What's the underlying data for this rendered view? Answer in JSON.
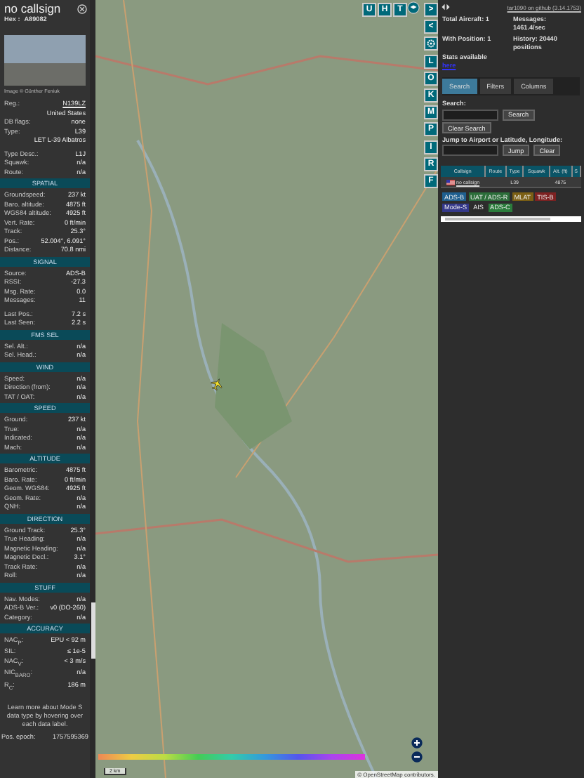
{
  "aircraft_panel": {
    "title": "no callsign",
    "hex_label": "Hex :",
    "hex": "A89082",
    "photo_caption": "Image © Günther Feniuk",
    "sections": [
      {
        "blocks": [
          [
            {
              "kind": "link",
              "label": "Reg.:",
              "value": "N139LZ"
            },
            {
              "kind": "value",
              "value": "United States"
            },
            {
              "kind": "pair",
              "label": "DB flags:",
              "value": "none"
            },
            {
              "kind": "pair",
              "label": "Type:",
              "value": "L39"
            },
            {
              "kind": "value",
              "value": "LET L-39 Albatros"
            }
          ],
          [
            {
              "kind": "pair",
              "label": "Type Desc.:",
              "value": "L1J"
            },
            {
              "kind": "pair",
              "label": "Squawk:",
              "value": "n/a"
            },
            {
              "kind": "pair",
              "label": "Route:",
              "value": "n/a"
            }
          ]
        ]
      },
      {
        "heading": "SPATIAL",
        "blocks": [
          [
            {
              "kind": "pair",
              "label": "Groundspeed:",
              "value": "237 kt"
            },
            {
              "kind": "pair",
              "label": "Baro. altitude:",
              "value": "4875 ft"
            },
            {
              "kind": "pair",
              "label": "WGS84 altitude:",
              "value": "4925 ft"
            },
            {
              "kind": "pair",
              "label": "Vert. Rate:",
              "value": "0 ft/min"
            },
            {
              "kind": "pair",
              "label": "Track:",
              "value": "25.3°"
            },
            {
              "kind": "pair",
              "label": "Pos.:",
              "value": "52.004°, 6.091°"
            },
            {
              "kind": "pair",
              "label": "Distance:",
              "value": "70.8 nmi"
            }
          ]
        ]
      },
      {
        "heading": "SIGNAL",
        "blocks": [
          [
            {
              "kind": "pair",
              "label": "Source:",
              "value": "ADS-B"
            },
            {
              "kind": "pair",
              "label": "RSSI:",
              "value": "-27.3"
            },
            {
              "kind": "pair",
              "label": "Msg. Rate:",
              "value": "0.0"
            },
            {
              "kind": "pair",
              "label": "Messages:",
              "value": "11"
            }
          ],
          [
            {
              "kind": "pair",
              "label": "Last Pos.:",
              "value": "7.2 s"
            },
            {
              "kind": "pair",
              "label": "Last Seen:",
              "value": "2.2 s"
            }
          ]
        ]
      },
      {
        "heading": "FMS SEL",
        "blocks": [
          [
            {
              "kind": "pair",
              "label": "Sel. Alt.:",
              "value": "n/a"
            },
            {
              "kind": "pair",
              "label": "Sel. Head.:",
              "value": "n/a"
            }
          ]
        ]
      },
      {
        "heading": "WIND",
        "blocks": [
          [
            {
              "kind": "pair",
              "label": "Speed:",
              "value": "n/a"
            },
            {
              "kind": "pair",
              "label": "Direction (from):",
              "value": "n/a"
            },
            {
              "kind": "pair",
              "label": "TAT / OAT:",
              "value": "n/a"
            }
          ]
        ]
      },
      {
        "heading": "SPEED",
        "blocks": [
          [
            {
              "kind": "pair",
              "label": "Ground:",
              "value": "237 kt"
            },
            {
              "kind": "pair",
              "label": "True:",
              "value": "n/a"
            },
            {
              "kind": "pair",
              "label": "Indicated:",
              "value": "n/a"
            },
            {
              "kind": "pair",
              "label": "Mach:",
              "value": "n/a"
            }
          ]
        ]
      },
      {
        "heading": "ALTITUDE",
        "blocks": [
          [
            {
              "kind": "pair",
              "label": "Barometric:",
              "value": "4875 ft"
            },
            {
              "kind": "pair",
              "label": "Baro. Rate:",
              "value": "0 ft/min"
            },
            {
              "kind": "pair",
              "label": "Geom. WGS84:",
              "value": "4925 ft"
            },
            {
              "kind": "pair",
              "label": "Geom. Rate:",
              "value": "n/a"
            },
            {
              "kind": "pair",
              "label": "QNH:",
              "value": "n/a"
            }
          ]
        ]
      },
      {
        "heading": "DIRECTION",
        "blocks": [
          [
            {
              "kind": "pair",
              "label": "Ground Track:",
              "value": "25.3°"
            },
            {
              "kind": "pair",
              "label": "True Heading:",
              "value": "n/a"
            },
            {
              "kind": "pair",
              "label": "Magnetic Heading:",
              "value": "n/a"
            },
            {
              "kind": "pair",
              "label": "Magnetic Decl.:",
              "value": "3.1°"
            },
            {
              "kind": "pair",
              "label": "Track Rate:",
              "value": "n/a"
            },
            {
              "kind": "pair",
              "label": "Roll:",
              "value": "n/a"
            }
          ]
        ]
      },
      {
        "heading": "STUFF",
        "blocks": [
          [
            {
              "kind": "pair",
              "label": "Nav. Modes:",
              "value": "n/a"
            },
            {
              "kind": "pair",
              "label": "ADS-B Ver.:",
              "value": "v0 (DO-260)"
            },
            {
              "kind": "pair",
              "label": "Category:",
              "value": "n/a"
            }
          ]
        ]
      },
      {
        "heading": "ACCURACY",
        "blocks": [
          [
            {
              "kind": "pair",
              "label": "NAC$_{P}$:",
              "value": "EPU < 92 m"
            },
            {
              "kind": "pair",
              "label": "SIL:",
              "value": "≤ 1e-5"
            },
            {
              "kind": "pair",
              "label": "NAC$_{V}$:",
              "value": "< 3 m/s"
            },
            {
              "kind": "pair",
              "label": "NIC$_{BARO}$:",
              "value": "n/a"
            },
            {
              "kind": "pair",
              "label": "R$_{C}$:",
              "value": "186 m"
            }
          ]
        ]
      }
    ],
    "note": "Learn more about Mode S data type by hovering over each data label.",
    "epoch_label": "Pos. epoch:",
    "epoch": "1757595369"
  },
  "map": {
    "top_buttons": [
      "U",
      "H",
      "T"
    ],
    "side_buttons": [
      {
        "kind": "text",
        "label": ">"
      },
      {
        "kind": "text",
        "label": "<"
      },
      {
        "kind": "gear"
      },
      {
        "kind": "text",
        "label": "L"
      },
      {
        "kind": "text",
        "label": "O"
      },
      {
        "kind": "text",
        "label": "K"
      },
      {
        "kind": "text",
        "label": "M"
      },
      {
        "kind": "text",
        "label": "P"
      },
      {
        "kind": "text",
        "label": "I"
      },
      {
        "kind": "text",
        "label": "R"
      },
      {
        "kind": "text",
        "label": "F"
      }
    ],
    "scale": "2 km",
    "attribution": "© OpenStreetMap contributors."
  },
  "sidebar": {
    "version": "tar1090 on github (3.14.1753)",
    "stats": [
      "Total Aircraft: 1",
      "Messages: 1461.4/sec",
      "With Position: 1",
      "History: 20440 positions"
    ],
    "stats_text": "Stats available",
    "stats_link": "here",
    "tabs": [
      {
        "label": "Search",
        "selected": true
      },
      {
        "label": "Filters",
        "selected": false
      },
      {
        "label": "Columns",
        "selected": false
      }
    ],
    "search_label": "Search:",
    "search_button": "Search",
    "clear_search_button": "Clear Search",
    "jump_label": "Jump to Airport or Latitude, Longitude:",
    "jump_button": "Jump",
    "clear_button": "Clear",
    "table": {
      "columns": [
        "Callsign",
        "Route",
        "Type",
        "Squawk",
        "Alt. (ft)",
        "S"
      ],
      "rows": [
        {
          "callsign": "no callsign",
          "type": "L39",
          "altitude": "4875"
        }
      ]
    },
    "legend": [
      {
        "label": "ADS-B",
        "color": "#1f5f8f"
      },
      {
        "label": "UAT / ADS-R",
        "color": "#2c6e3a"
      },
      {
        "label": "MLAT",
        "color": "#7c5f14"
      },
      {
        "label": "TIS-B",
        "color": "#7e2222"
      },
      {
        "label": "Mode-S",
        "color": "#34388a"
      },
      {
        "label": "AIS",
        "color": "#2b2b2b"
      },
      {
        "label": "ADS-C",
        "color": "#2b7c3c"
      }
    ]
  }
}
